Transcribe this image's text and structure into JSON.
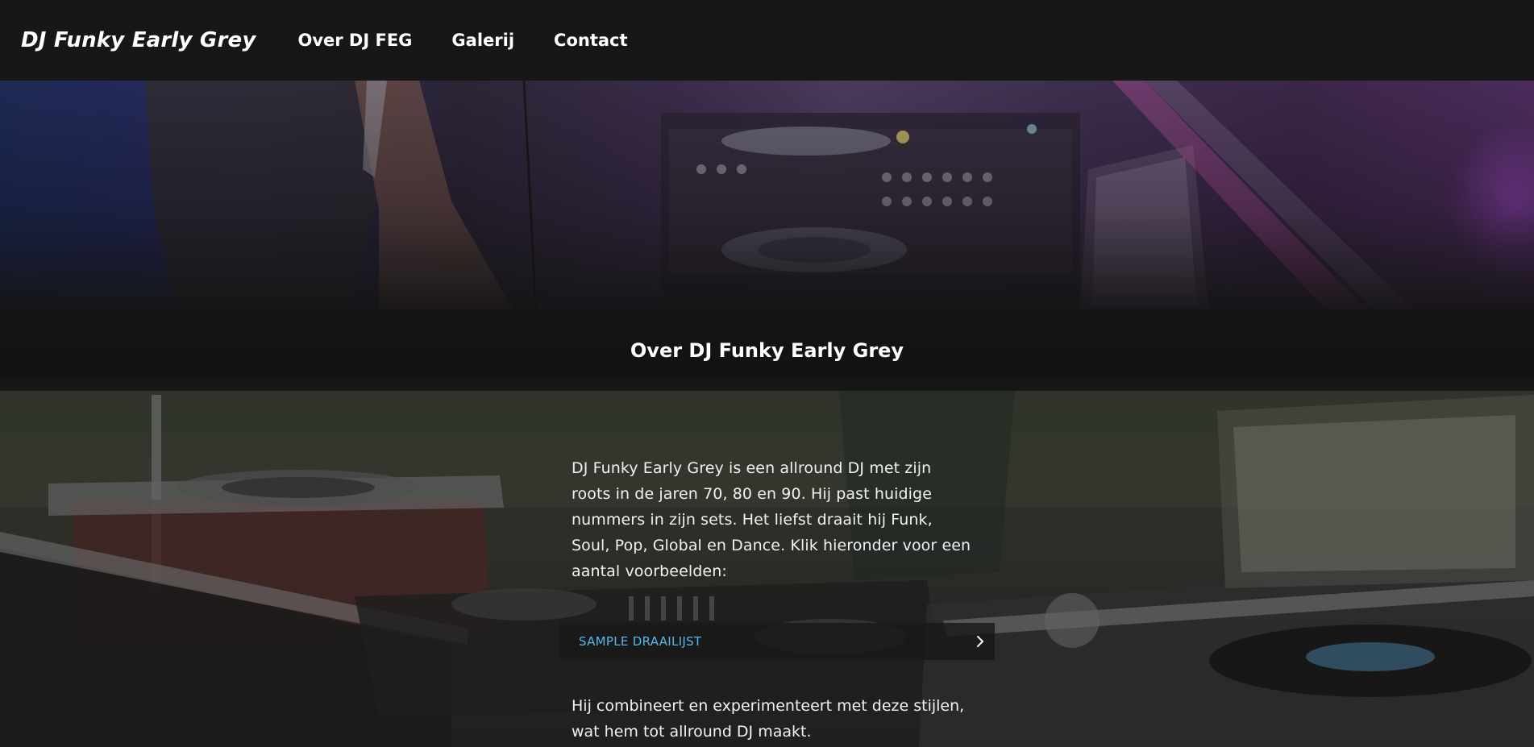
{
  "navbar": {
    "brand": "DJ Funky Early Grey",
    "links": [
      {
        "label": "Over DJ FEG"
      },
      {
        "label": "Galerij"
      },
      {
        "label": "Contact"
      }
    ]
  },
  "section": {
    "title": "Over DJ Funky Early Grey"
  },
  "content": {
    "intro": "DJ Funky Early Grey is een allround DJ met zijn roots in de jaren 70, 80 en 90. Hij past huidige nummers in zijn sets. Het liefst draait hij Funk, Soul, Pop, Global en Dance. Klik hieronder voor een aantal voorbeelden:",
    "sample_button": {
      "label": "SAMPLE DRAAILIJST",
      "icon": "chevron-right-icon"
    },
    "outro": "Hij combineert en experimenteert met deze stijlen, wat hem tot allround DJ maakt."
  },
  "colors": {
    "navbar_bg": "#171717",
    "page_bg": "#141414",
    "accent_link": "#5bb7e8",
    "text": "#ffffff"
  }
}
